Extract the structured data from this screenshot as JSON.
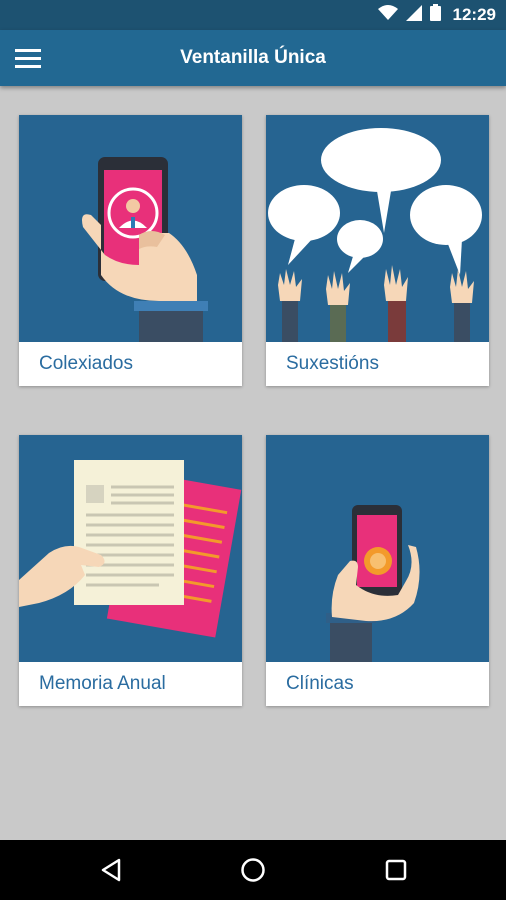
{
  "status_bar": {
    "time": "12:29",
    "icons": [
      "wifi-icon",
      "cellular-signal-icon",
      "battery-icon"
    ]
  },
  "app_bar": {
    "title": "Ventanilla Única",
    "menu_icon": "hamburger-menu-icon"
  },
  "tiles": [
    {
      "label": "Colexiados",
      "illustration": "hand-holding-phone-doctor-icon"
    },
    {
      "label": "Suxestións",
      "illustration": "speech-bubbles-raised-hands-icon"
    },
    {
      "label": "Memoria Anual",
      "illustration": "hand-holding-documents-icon"
    },
    {
      "label": "Clínicas",
      "illustration": "hand-holding-phone-touch-icon"
    }
  ],
  "nav_bar": {
    "buttons": [
      "back-icon",
      "home-icon",
      "recents-icon"
    ]
  },
  "colors": {
    "status_bar": "#1d5271",
    "app_bar": "#226892",
    "tile_art": "#266491",
    "label_text": "#2a6ca0",
    "background": "#c9c9c9",
    "accent_pink": "#e8307a",
    "accent_orange": "#f39a2b"
  }
}
